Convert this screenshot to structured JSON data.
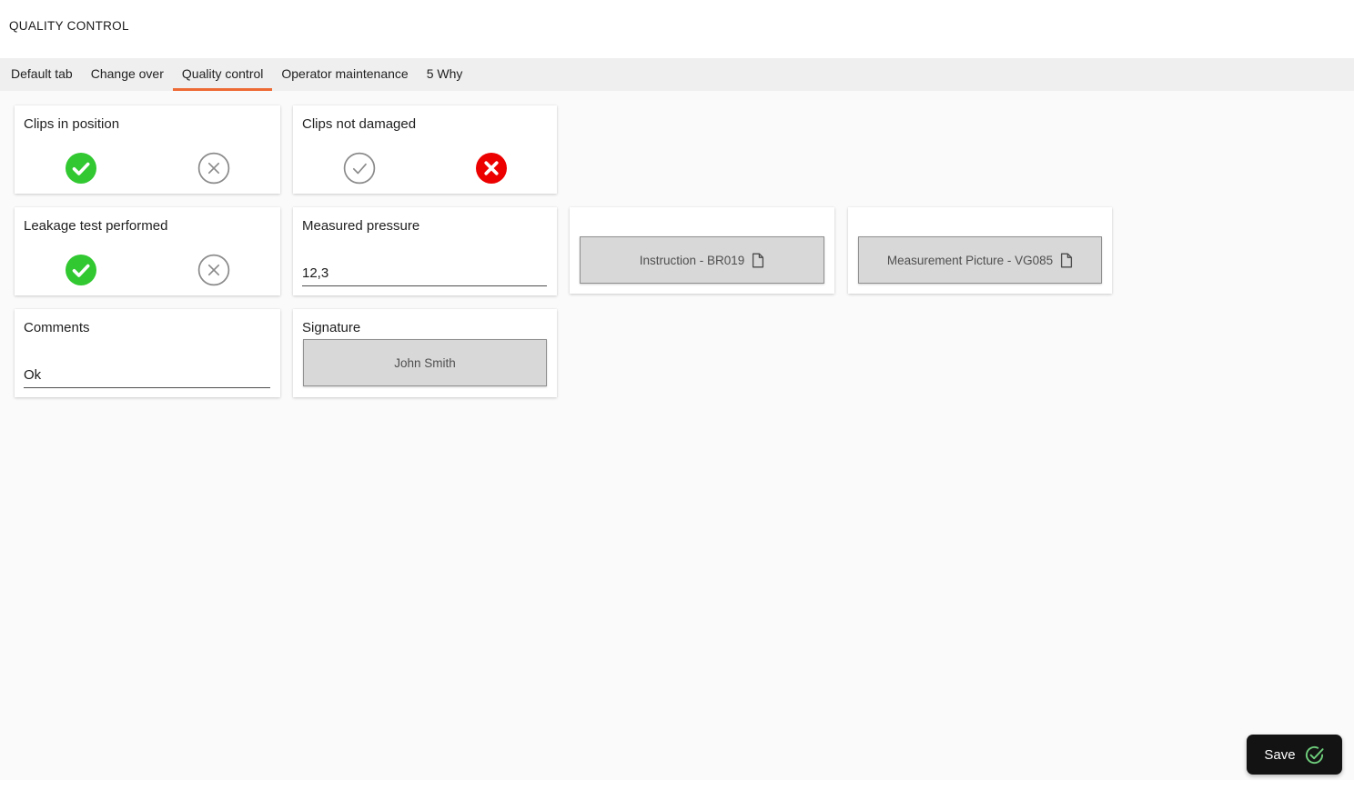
{
  "title": "QUALITY CONTROL",
  "tabs": [
    {
      "label": "Default tab"
    },
    {
      "label": "Change over"
    },
    {
      "label": "Quality control"
    },
    {
      "label": "Operator maintenance"
    },
    {
      "label": "5 Why"
    }
  ],
  "active_tab": "Quality control",
  "cards": {
    "clips_in_position": {
      "label": "Clips in position",
      "state": "pass"
    },
    "clips_not_damaged": {
      "label": "Clips not damaged",
      "state": "fail"
    },
    "leakage_test_performed": {
      "label": "Leakage test performed",
      "state": "pass"
    },
    "measured_pressure": {
      "label": "Measured pressure",
      "value": "12,3"
    },
    "instruction": {
      "button_label": "Instruction - BR019"
    },
    "measurement_picture": {
      "button_label": "Measurement Picture - VG085"
    },
    "comments": {
      "label": "Comments",
      "value": "Ok"
    },
    "signature": {
      "label": "Signature",
      "button_label": "John Smith"
    }
  },
  "save_button": {
    "label": "Save"
  },
  "colors": {
    "accent_orange": "#ED6A35",
    "pass_green": "#31C831",
    "fail_red": "#EC0000",
    "save_icon_green": "#6FCE7C",
    "tabbar_bg": "#EFEFEF",
    "content_bg": "#FAFAFA"
  }
}
